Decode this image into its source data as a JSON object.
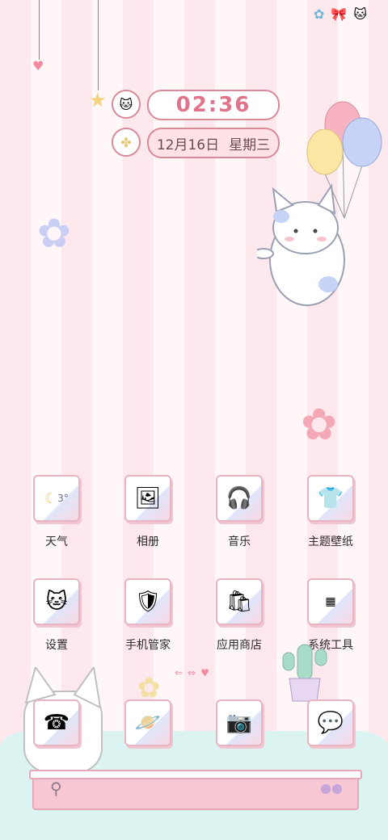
{
  "status_icons": [
    "flower-icon",
    "bow-icon",
    "cat-icon"
  ],
  "clock": {
    "time": "02:36",
    "date": "12月16日",
    "weekday": "星期三"
  },
  "apps_row1": [
    {
      "label": "天气",
      "icon": "weather-icon",
      "temp": "3°"
    },
    {
      "label": "相册",
      "icon": "gallery-icon"
    },
    {
      "label": "音乐",
      "icon": "music-icon"
    },
    {
      "label": "主题壁纸",
      "icon": "theme-icon"
    }
  ],
  "apps_row2": [
    {
      "label": "设置",
      "icon": "settings-icon"
    },
    {
      "label": "手机管家",
      "icon": "phone-manager-icon"
    },
    {
      "label": "应用商店",
      "icon": "app-store-icon"
    },
    {
      "label": "系统工具",
      "icon": "system-tools-icon"
    }
  ],
  "dock_apps": [
    {
      "icon": "phone-icon"
    },
    {
      "icon": "browser-icon"
    },
    {
      "icon": "camera-icon"
    },
    {
      "icon": "messages-icon"
    }
  ],
  "colors": {
    "accent": "#e0738a",
    "border": "#d98a98",
    "dock": "#f7c8d3",
    "cloud": "#dcf4f1"
  }
}
